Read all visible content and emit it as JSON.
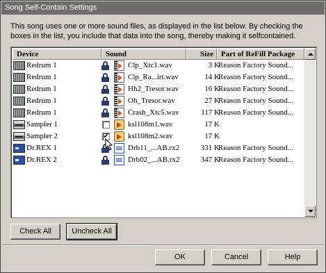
{
  "window": {
    "title": "Song Self-Contain Settings"
  },
  "description": "This song uses one or more sound files, as displayed in the list below. By checking the boxes in the list, you include that data into the song, thereby making it selfcontained.",
  "columns": {
    "device": "Device",
    "sound": "Sound",
    "size": "Size",
    "package": "Part of ReFill Package"
  },
  "rows": [
    {
      "device": "Redrum 1",
      "device_icon": "redrum-icon",
      "state": "locked",
      "file": "Clp_Xtc1.wav",
      "size": "3 K",
      "package": "Reason Factory Sound..."
    },
    {
      "device": "Redrum 1",
      "device_icon": "redrum-icon",
      "state": "locked",
      "file": "Clp_Ra...irt.wav",
      "size": "14 K",
      "package": "Reason Factory Sound..."
    },
    {
      "device": "Redrum 1",
      "device_icon": "redrum-icon",
      "state": "locked",
      "file": "Hh2_Tresor.wav",
      "size": "16 K",
      "package": "Reason Factory Sound..."
    },
    {
      "device": "Redrum 1",
      "device_icon": "redrum-icon",
      "state": "locked",
      "file": "Oh_Tresor.wav",
      "size": "27 K",
      "package": "Reason Factory Sound..."
    },
    {
      "device": "Redrum 1",
      "device_icon": "redrum-icon",
      "state": "locked",
      "file": "Crash_Xtc5.wav",
      "size": "117 K",
      "package": "Reason Factory Sound..."
    },
    {
      "device": "Sampler 1",
      "device_icon": "sampler-icon",
      "state": "unchecked",
      "file": "ksl108m1.wav",
      "size": "17 K",
      "package": ""
    },
    {
      "device": "Sampler 2",
      "device_icon": "sampler-icon",
      "state": "checked",
      "file": "ksl108m2.wav",
      "size": "17 K",
      "package": ""
    },
    {
      "device": "Dr.REX 1",
      "device_icon": "drrex-icon",
      "state": "locked",
      "file": "Drb11_...AB.rx2",
      "size": "331 K",
      "package": "Reason Factory Sound..."
    },
    {
      "device": "Dr.REX 2",
      "device_icon": "drrex-icon",
      "state": "locked",
      "file": "Drb02_...AB.rx2",
      "size": "347 K",
      "package": "Reason Factory Sound..."
    }
  ],
  "buttons": {
    "check_all": "Check All",
    "uncheck_all": "Uncheck All",
    "ok": "OK",
    "cancel": "Cancel",
    "help": "Help"
  },
  "checkmark": "✔"
}
